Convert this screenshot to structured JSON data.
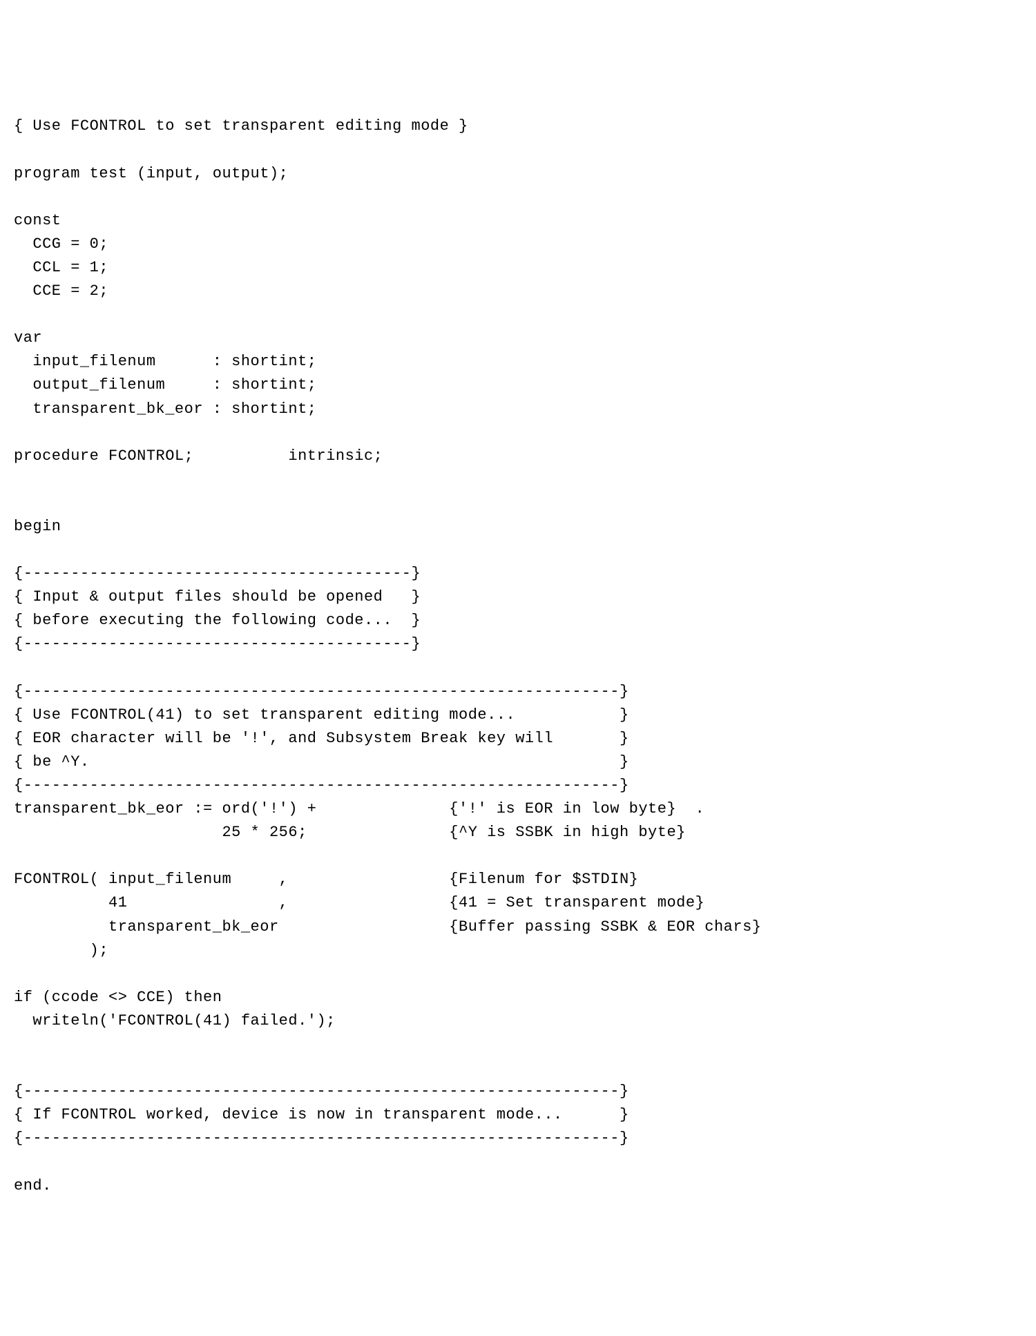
{
  "code": {
    "l01": "{ Use FCONTROL to set transparent editing mode }",
    "l02": "",
    "l03": "program test (input, output);",
    "l04": "",
    "l05": "const",
    "l06": "  CCG = 0;",
    "l07": "  CCL = 1;",
    "l08": "  CCE = 2;",
    "l09": "",
    "l10": "var",
    "l11": "  input_filenum      : shortint;",
    "l12": "  output_filenum     : shortint;",
    "l13": "  transparent_bk_eor : shortint;",
    "l14": "",
    "l15": "procedure FCONTROL;          intrinsic;",
    "l16": "",
    "l17": "",
    "l18": "begin",
    "l19": "",
    "l20": "{-----------------------------------------}",
    "l21": "{ Input & output files should be opened   }",
    "l22": "{ before executing the following code...  }",
    "l23": "{-----------------------------------------}",
    "l24": "",
    "l25": "{---------------------------------------------------------------}",
    "l26": "{ Use FCONTROL(41) to set transparent editing mode...           }",
    "l27": "{ EOR character will be '!', and Subsystem Break key will       }",
    "l28": "{ be ^Y.                                                        }",
    "l29": "{---------------------------------------------------------------}",
    "l30": "transparent_bk_eor := ord('!') +              {'!' is EOR in low byte}  .",
    "l31": "                      25 * 256;               {^Y is SSBK in high byte}",
    "l32": "",
    "l33": "FCONTROL( input_filenum     ,                 {Filenum for $STDIN}",
    "l34": "          41                ,                 {41 = Set transparent mode}",
    "l35": "          transparent_bk_eor                  {Buffer passing SSBK & EOR chars}",
    "l36": "        );",
    "l37": "",
    "l38": "if (ccode <> CCE) then",
    "l39": "  writeln('FCONTROL(41) failed.');",
    "l40": "",
    "l41": "",
    "l42": "{---------------------------------------------------------------}",
    "l43": "{ If FCONTROL worked, device is now in transparent mode...      }",
    "l44": "{---------------------------------------------------------------}",
    "l45": "",
    "l46": "end."
  }
}
